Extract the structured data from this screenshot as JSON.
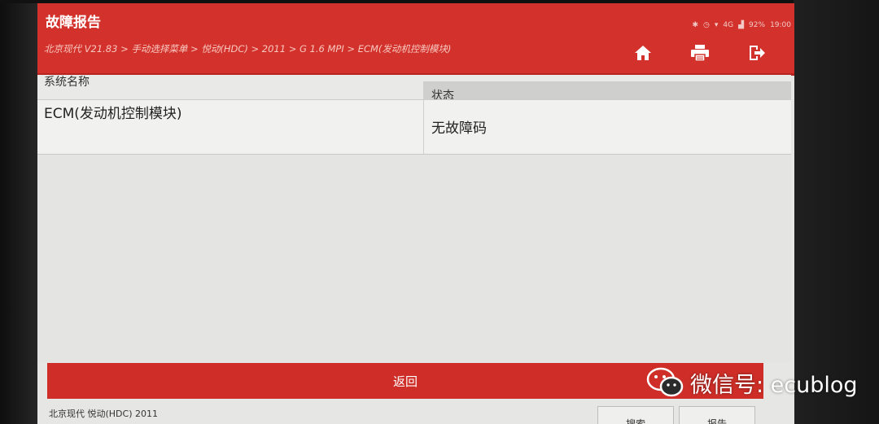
{
  "app": {
    "title": "故障报告"
  },
  "status_bar": {
    "battery": "92%",
    "time": "19:00",
    "network": "4G"
  },
  "breadcrumb": "北京现代 V21.83 > 手动选择菜单 > 悦动(HDC) > 2011 > G 1.6 MPI > ECM(发动机控制模块)",
  "nav": {
    "home_icon": "home-icon",
    "print_icon": "print-icon",
    "exit_icon": "exit-icon"
  },
  "table": {
    "headers": {
      "name": "系统名称",
      "status": "状态"
    },
    "rows": [
      {
        "name": "ECM(发动机控制模块)",
        "status": "无故障码"
      }
    ]
  },
  "back_button": "返回",
  "footer": {
    "vehicle": "北京现代 悦动(HDC) 2011",
    "buttons": [
      "搜索",
      "报告"
    ]
  },
  "watermark": {
    "text": "微信号: ecublog"
  },
  "colors": {
    "accent": "#d3322c",
    "background": "#e6e6e4"
  }
}
